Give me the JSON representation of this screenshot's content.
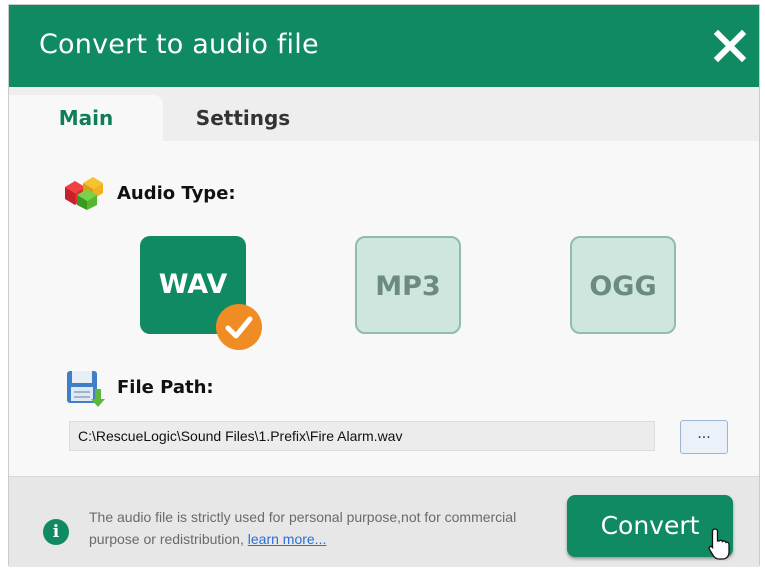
{
  "dialog": {
    "title": "Convert to audio file",
    "close_icon": "close-icon"
  },
  "tabs": [
    {
      "label": "Main",
      "active": true
    },
    {
      "label": "Settings",
      "active": false
    }
  ],
  "audio_type": {
    "label": "Audio Type:",
    "icon": "cubes-icon",
    "formats": [
      {
        "label": "WAV",
        "selected": true
      },
      {
        "label": "MP3",
        "selected": false
      },
      {
        "label": "OGG",
        "selected": false
      }
    ]
  },
  "file_path": {
    "label": "File Path:",
    "icon": "save-file-icon",
    "value": "C:\\RescueLogic\\Sound Files\\1.Prefix\\Fire Alarm.wav",
    "browse_label": "..."
  },
  "footer": {
    "notice_text": "The audio file is strictly used for personal purpose,not for commercial purpose or redistribution,",
    "learn_more": "learn more...",
    "convert_label": "Convert"
  },
  "colors": {
    "brand_green": "#0f8a63",
    "selected_badge": "#f08c24",
    "inactive_format": "#cfe6df",
    "link": "#2a6fd6"
  }
}
